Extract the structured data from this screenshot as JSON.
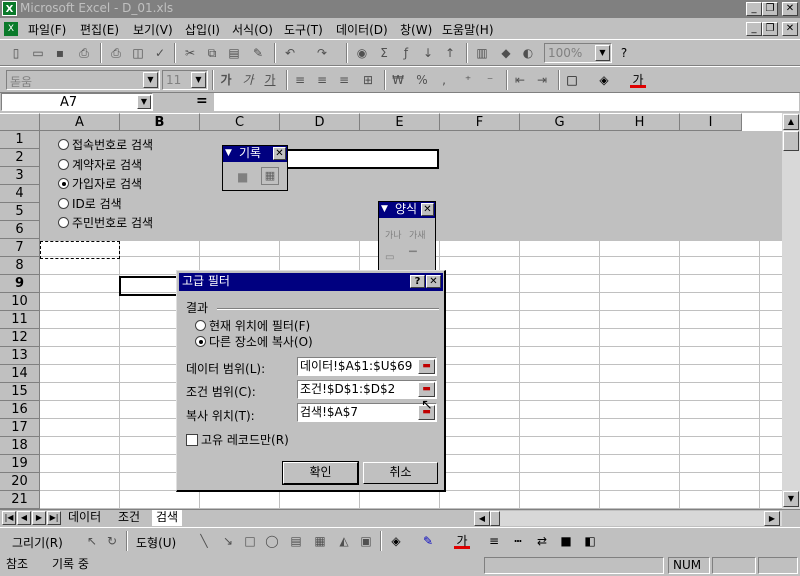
{
  "window": {
    "title": "Microsoft Excel - D_01.xls",
    "app_icon": "excel-icon"
  },
  "menu": {
    "items": [
      "파일(F)",
      "편집(E)",
      "보기(V)",
      "삽입(I)",
      "서식(O)",
      "도구(T)",
      "데이터(D)",
      "창(W)",
      "도움말(H)"
    ]
  },
  "toolbar": {
    "zoom": "100%",
    "font_name": "돋움",
    "font_size": "11",
    "bold": "가",
    "italic": "가",
    "underline": "가",
    "percent": "%",
    "currency": "₩",
    "font_color_letter": "가"
  },
  "formula": {
    "name_box": "A7",
    "equals": "="
  },
  "grid": {
    "columns": [
      "A",
      "B",
      "C",
      "D",
      "E",
      "F",
      "G",
      "H",
      "I"
    ],
    "rows": [
      "1",
      "2",
      "3",
      "4",
      "5",
      "6",
      "7",
      "8",
      "9",
      "10",
      "11",
      "12",
      "13",
      "14",
      "15",
      "16",
      "17",
      "18",
      "19",
      "20",
      "21"
    ],
    "active_column": "B",
    "active_row": "9",
    "radio_options": [
      {
        "label": "접속번호로 검색",
        "selected": false
      },
      {
        "label": "계약자로 검색",
        "selected": false
      },
      {
        "label": "가입자로 검색",
        "selected": true
      },
      {
        "label": "ID로 검색",
        "selected": false
      },
      {
        "label": "주민번호로 검색",
        "selected": false
      }
    ]
  },
  "record_toolbar": {
    "title": "기록"
  },
  "forms_toolbar": {
    "title": "양식",
    "label_tool": "가나",
    "groupbox_tool": "가새"
  },
  "dialog": {
    "title": "고급 필터",
    "help": "?",
    "result_label": "결과",
    "option_filter_in_place": "현재 위치에 필터(F)",
    "option_copy_to": "다른 장소에 복사(O)",
    "data_range_label": "데이터 범위(L):",
    "data_range_value": "데이터!$A$1:$U$69",
    "criteria_range_label": "조건 범위(C):",
    "criteria_range_value": "조건!$D$1:$D$2",
    "copy_to_label": "복사 위치(T):",
    "copy_to_value": "검색!$A$7",
    "unique_label": "고유 레코드만(R)",
    "ok": "확인",
    "cancel": "취소"
  },
  "sheets": {
    "tabs": [
      {
        "name": "데이터",
        "active": false
      },
      {
        "name": "조건",
        "active": false
      },
      {
        "name": "검색",
        "active": true
      }
    ]
  },
  "drawbar": {
    "draw_label": "그리기(R)",
    "autoshape_label": "도형(U)",
    "font_color_letter": "가"
  },
  "status": {
    "mode": "참조",
    "recording": "기록 중",
    "num": "NUM"
  }
}
